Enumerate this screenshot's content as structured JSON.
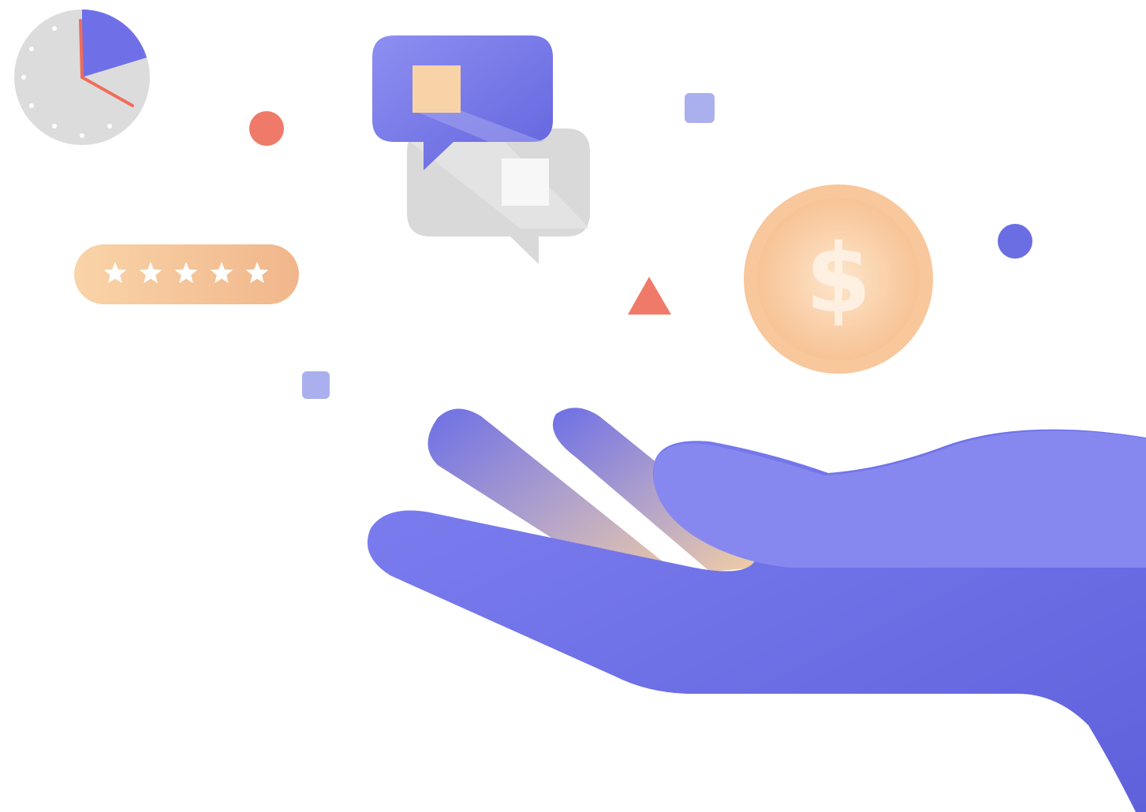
{
  "illustration": {
    "coin_symbol": "$",
    "rating_stars": 5,
    "rating_max": 5,
    "icons": [
      "clock-icon",
      "star-rating-icon",
      "chat-bubbles-icon",
      "dollar-coin-icon",
      "open-hand-icon",
      "triangle-icon",
      "dot-icon",
      "square-icon"
    ]
  },
  "colors": {
    "indigo": "#6b6de3",
    "indigo_light": "#8d8ef2",
    "coral": "#f07a6a",
    "peach": "#f7c79a",
    "peach_light": "#fbdcbd",
    "gray": "#dcdcdc",
    "white": "#ffffff"
  }
}
